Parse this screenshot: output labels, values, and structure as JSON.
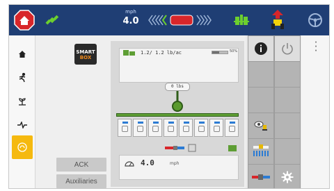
{
  "topbar": {
    "speed_unit": "mph",
    "speed_value": "4.0"
  },
  "main": {
    "smartbox": {
      "line1": "SMART",
      "line2": "BOX"
    },
    "ack_label": "ACK",
    "auxiliaries_label": "Auxiliaries",
    "rate": {
      "text": "1.2/  1.2  lb/ac",
      "bar_fill_pct": 45,
      "bar_pct_label": "50%"
    },
    "bin_value": "0 lbs",
    "row_count": 8,
    "speed": {
      "value": "4.0",
      "unit": "mph"
    }
  },
  "colors": {
    "topbar": "#1f3e74",
    "accent_yellow": "#f5b90f",
    "implement_green": "#5e9e34",
    "stop_red": "#d8262a"
  },
  "icons": {
    "top": [
      "stop-home-icon",
      "gps-satellite-icon",
      "steer-chevrons-icon",
      "implement-icon",
      "tractor-icon",
      "steering-wheel-icon"
    ],
    "left": [
      "home-icon",
      "runner-icon",
      "plant-icon",
      "pulse-icon",
      "sun-icon"
    ],
    "right": [
      "info-icon",
      "power-icon",
      "camera-icon",
      "section-control-icon",
      "flow-icon",
      "settings-gear-icon"
    ]
  }
}
